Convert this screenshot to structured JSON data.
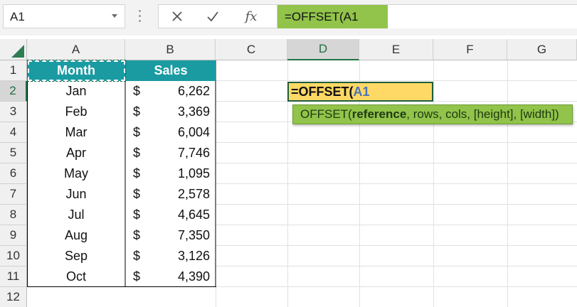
{
  "name_box": {
    "value": "A1"
  },
  "formula_bar": {
    "cancel_icon": "close-icon",
    "enter_icon": "check-icon",
    "fx_label": "fx",
    "formula": "=OFFSET(A1"
  },
  "columns": [
    "A",
    "B",
    "C",
    "D",
    "E",
    "F",
    "G"
  ],
  "rows": [
    "1",
    "2",
    "3",
    "4",
    "5",
    "6",
    "7",
    "8",
    "9",
    "10",
    "11",
    "12"
  ],
  "table": {
    "headers": [
      "Month",
      "Sales"
    ],
    "currency_symbol": "$",
    "rows": [
      {
        "month": "Jan",
        "sales": "6,262"
      },
      {
        "month": "Feb",
        "sales": "3,369"
      },
      {
        "month": "Mar",
        "sales": "6,004"
      },
      {
        "month": "Apr",
        "sales": "7,746"
      },
      {
        "month": "May",
        "sales": "1,095"
      },
      {
        "month": "Jun",
        "sales": "2,578"
      },
      {
        "month": "Jul",
        "sales": "4,645"
      },
      {
        "month": "Aug",
        "sales": "7,350"
      },
      {
        "month": "Sep",
        "sales": "3,126"
      },
      {
        "month": "Oct",
        "sales": "4,390"
      }
    ]
  },
  "active_cell": {
    "address": "D2",
    "formula_prefix": "=OFFSET(",
    "formula_ref": "A1"
  },
  "tooltip": {
    "func": "OFFSET(",
    "bold_arg": "reference",
    "rest": ", rows, cols, [height], [width])"
  },
  "colors": {
    "header_fill": "#1a9ba2",
    "formula_highlight": "#92c34a",
    "edit_cell_fill": "#ffd966",
    "excel_green": "#217346"
  }
}
